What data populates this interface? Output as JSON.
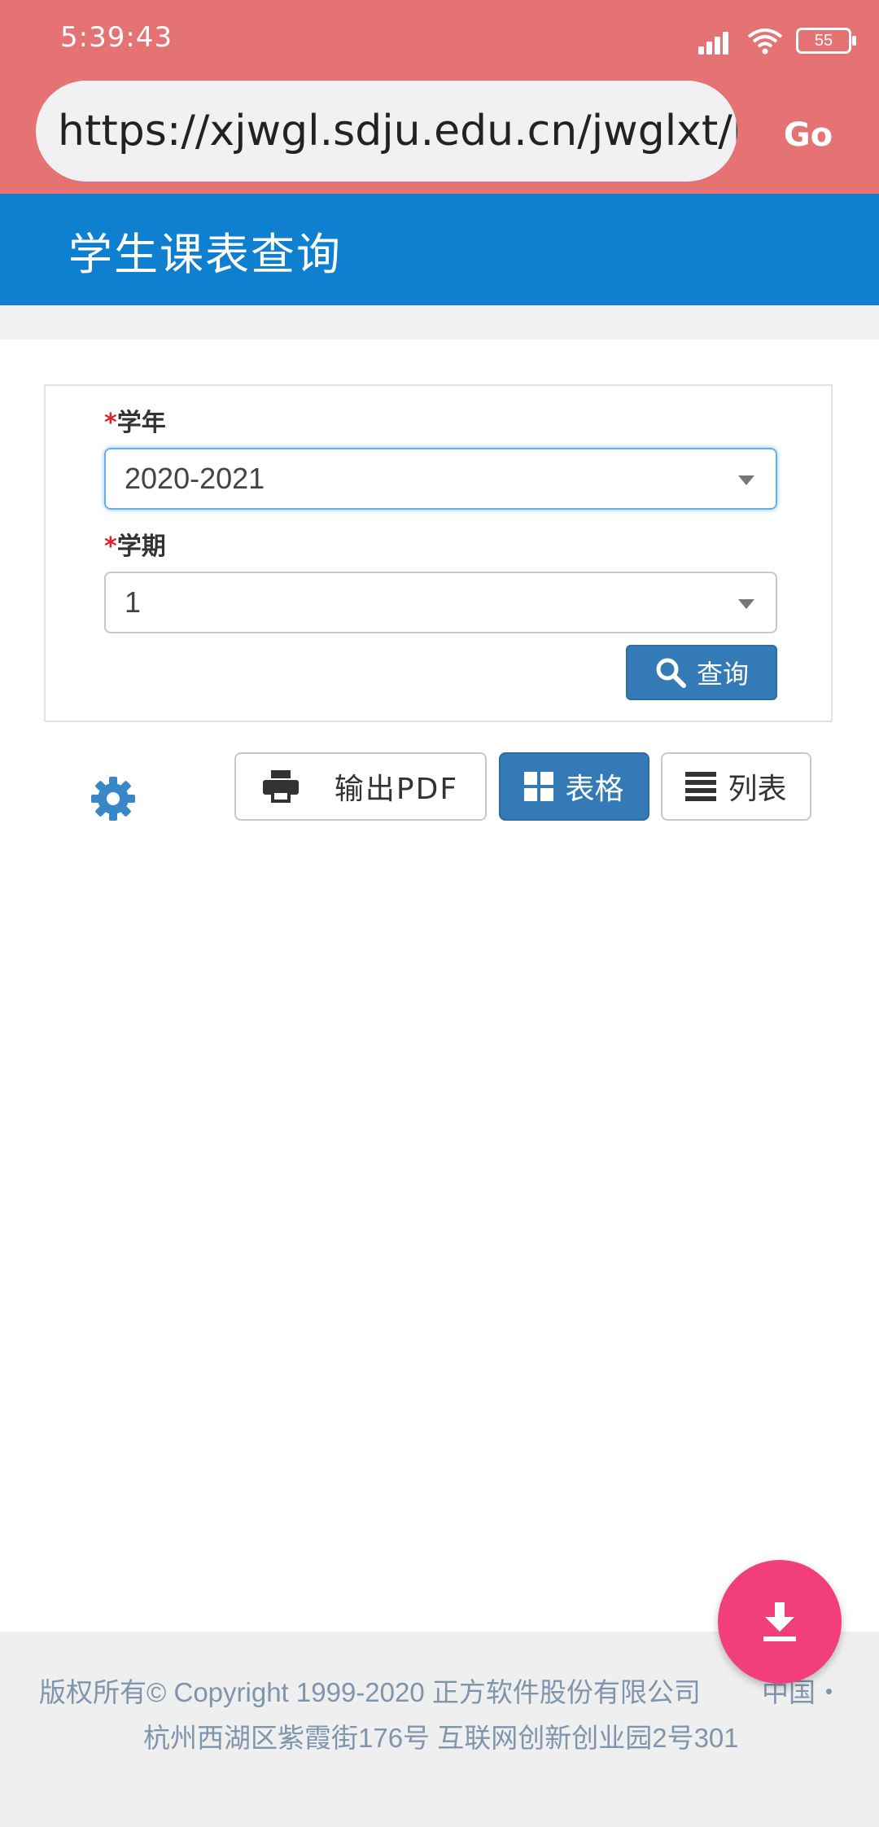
{
  "status_bar": {
    "time": "5:39:43",
    "battery_level": "55",
    "icons": [
      "signal-icon",
      "wifi-icon",
      "battery-icon"
    ]
  },
  "browser": {
    "url": "https://xjwgl.sdju.edu.cn/jwglxt/kbcx/xskbcx_cxXskbcxIndex.html",
    "go_label": "Go"
  },
  "header": {
    "title": "学生课表查询"
  },
  "form": {
    "year": {
      "required_mark": "*",
      "label": "学年",
      "value": "2020-2021"
    },
    "term": {
      "required_mark": "*",
      "label": "学期",
      "value": "1"
    },
    "search_label": "查询"
  },
  "toolbar": {
    "settings_icon": "gear-icon",
    "pdf_label": "输出PDF",
    "table_label": "表格",
    "list_label": "列表"
  },
  "footer": {
    "copyright": "版权所有© Copyright 1999-2020 正方软件股份有限公司",
    "lang": "中国・",
    "address": "杭州西湖区紫霞街176号 互联网创新创业园2号301"
  },
  "colors": {
    "status_bar": "#e57373",
    "header": "#0f7fd0",
    "primary_button": "#337ab7",
    "fab": "#f23f7b",
    "required": "#d9262c"
  }
}
